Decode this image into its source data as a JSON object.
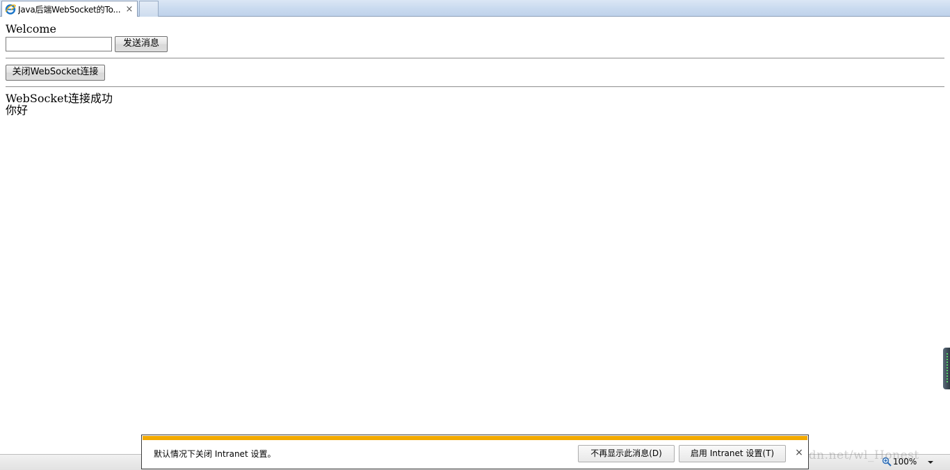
{
  "browser": {
    "tab_title": "Java后端WebSocket的To...",
    "tab_close": "×",
    "tab_icon": "ie-icon"
  },
  "page": {
    "welcome_text": "Welcome",
    "message_input_value": "",
    "send_button_label": "发送消息",
    "close_ws_button_label": "关闭WebSocket连接",
    "log_lines": [
      "WebSocket连接成功",
      "你好"
    ]
  },
  "statusbar": {
    "zoom_level": "100%",
    "zoom_icon": "zoom-icon",
    "zoom_dropdown_icon": "chevron-down-icon"
  },
  "notification": {
    "message": "默认情况下关闭 Intranet 设置。",
    "dismiss_button_label": "不再显示此消息(D)",
    "enable_button_label": "启用 Intranet 设置(T)",
    "close_glyph": "×",
    "accent_color": "#f2a900"
  },
  "watermark": {
    "text": "http://blog.csdn.net/wl_Honest"
  }
}
